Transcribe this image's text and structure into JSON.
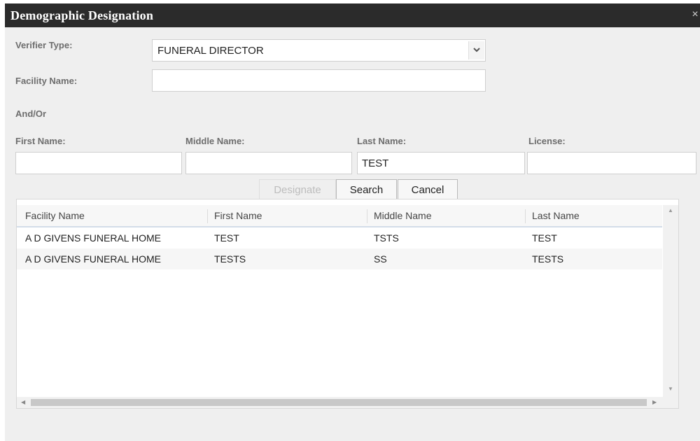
{
  "dialog": {
    "title": "Demographic Designation",
    "close_symbol": "×"
  },
  "form": {
    "verifier_type_label": "Verifier Type:",
    "verifier_type_value": "FUNERAL DIRECTOR",
    "facility_name_label": "Facility Name:",
    "facility_name_value": "",
    "and_or_label": "And/Or",
    "first_name_label": "First Name:",
    "middle_name_label": "Middle Name:",
    "last_name_label": "Last Name:",
    "license_label": "License:",
    "first_name_value": "",
    "middle_name_value": "",
    "last_name_value": "TEST",
    "license_value": ""
  },
  "buttons": {
    "designate": "Designate",
    "search": "Search",
    "cancel": "Cancel"
  },
  "grid": {
    "columns": [
      "Facility Name",
      "First Name",
      "Middle Name",
      "Last Name"
    ],
    "rows": [
      [
        "A D GIVENS FUNERAL HOME",
        "TEST",
        "TSTS",
        "TEST"
      ],
      [
        "A D GIVENS FUNERAL HOME",
        "TESTS",
        "SS",
        "TESTS"
      ]
    ]
  },
  "icons": {
    "dropdown": "chevron-down-icon",
    "close": "close-icon",
    "scroll_up": "scroll-up-icon",
    "scroll_down": "scroll-down-icon",
    "scroll_left": "scroll-left-icon",
    "scroll_right": "scroll-right-icon"
  },
  "colors": {
    "titlebar": "#2b2b2b",
    "dialog_bg": "#efefef",
    "label": "#6d6d6d",
    "header_underline": "#d3dde9"
  }
}
